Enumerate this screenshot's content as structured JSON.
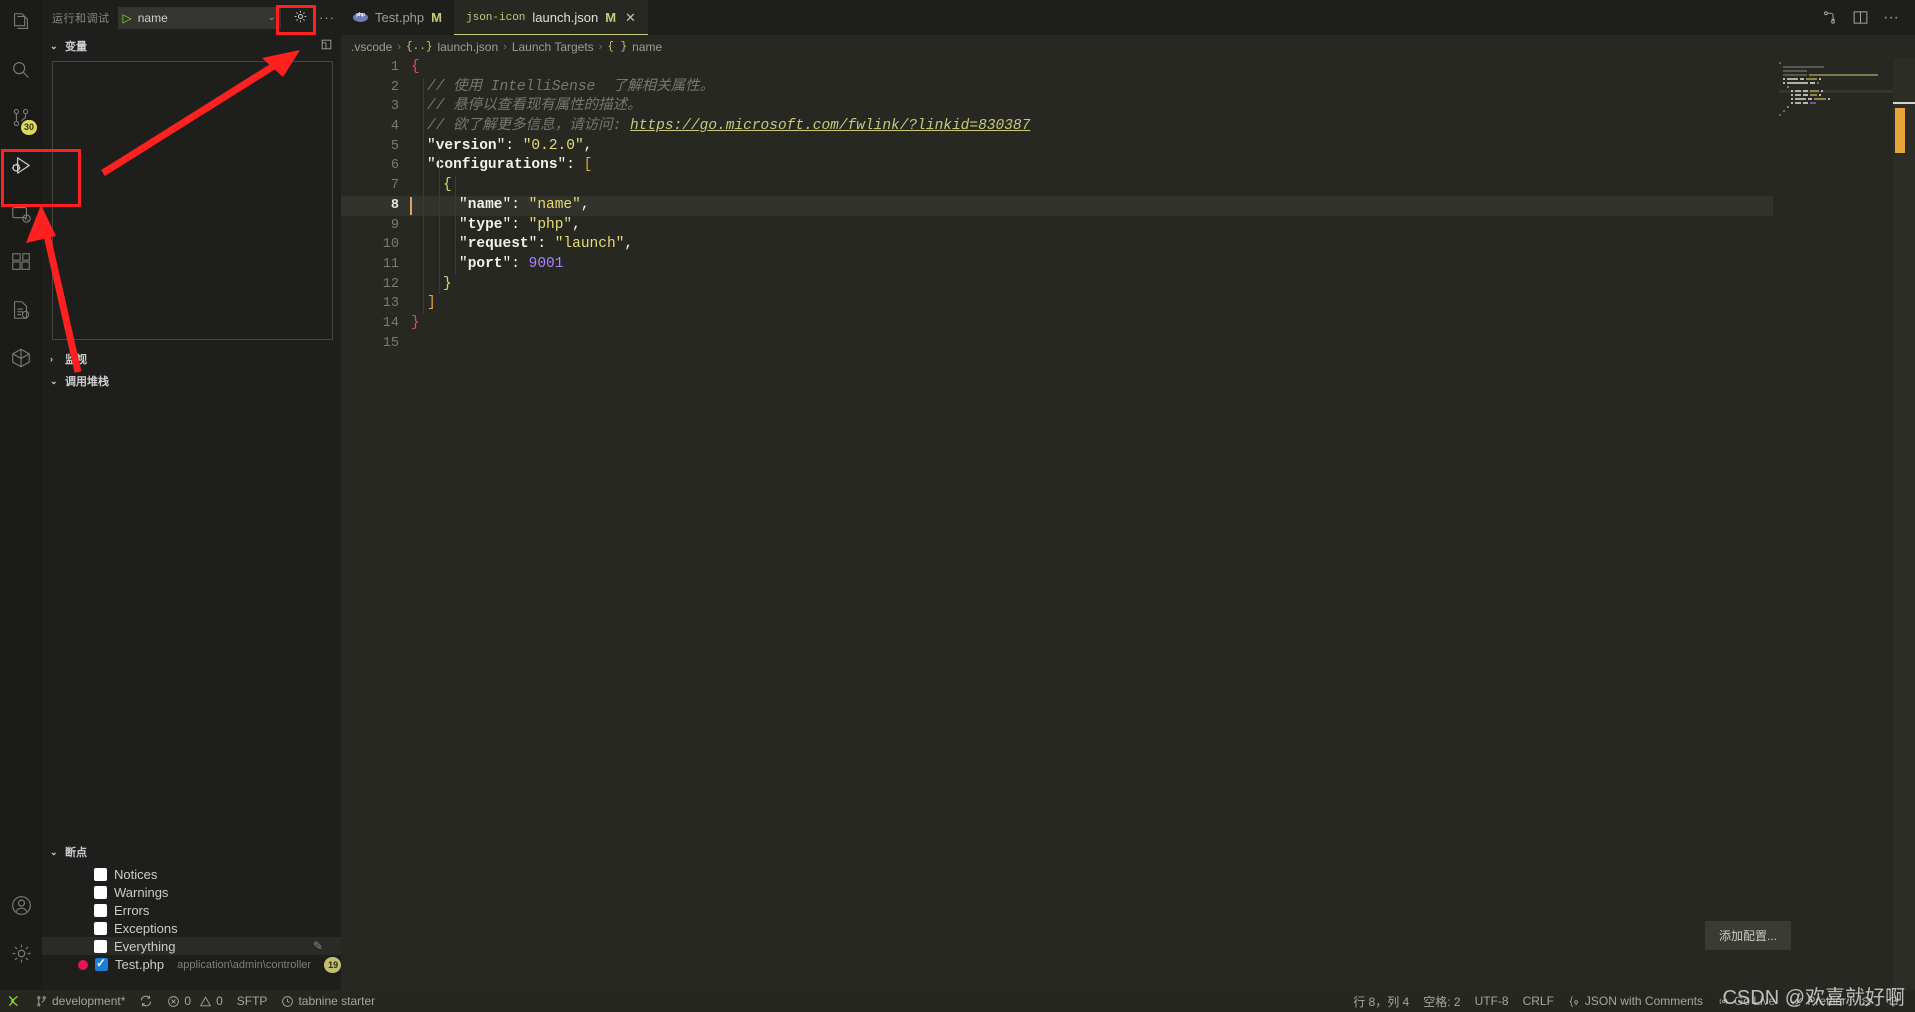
{
  "activity_bar": {
    "items": [
      {
        "name": "explorer",
        "icon": "files-icon",
        "badge": ""
      },
      {
        "name": "search",
        "icon": "search-icon",
        "badge": ""
      },
      {
        "name": "source-control",
        "icon": "source-control-icon",
        "badge": "30"
      },
      {
        "name": "run-and-debug",
        "icon": "run-debug-icon",
        "badge": "",
        "active": true
      },
      {
        "name": "remote-explorer",
        "icon": "remote-explorer-icon",
        "badge": ""
      },
      {
        "name": "extensions",
        "icon": "extensions-icon",
        "badge": ""
      },
      {
        "name": "test-explorer",
        "icon": "test-file-icon",
        "badge": ""
      },
      {
        "name": "docker",
        "icon": "docker-cube-icon",
        "badge": ""
      }
    ],
    "bottom_items": [
      {
        "name": "accounts",
        "icon": "account-icon"
      },
      {
        "name": "manage-settings",
        "icon": "gear-icon"
      }
    ]
  },
  "sidebar": {
    "title": "运行和调试",
    "config_name": "name",
    "play_glyph": "▷",
    "chevron_glyph": "⌄",
    "gear_icon": "gear-icon",
    "more_icon": "ellipsis-icon",
    "sections": {
      "variables": {
        "label": "变量",
        "expanded": true,
        "twist": "⌄",
        "action_icon": "open-in-editor-icon"
      },
      "watch": {
        "label": "监视",
        "expanded": false,
        "twist": "›"
      },
      "callstack": {
        "label": "调用堆栈",
        "expanded": true,
        "twist": "⌄"
      },
      "breakpoints": {
        "label": "断点",
        "expanded": true,
        "twist": "⌄"
      }
    },
    "breakpoints": [
      {
        "label": "Notices",
        "checked": false,
        "highlight": false
      },
      {
        "label": "Warnings",
        "checked": false,
        "highlight": false
      },
      {
        "label": "Errors",
        "checked": false,
        "highlight": false
      },
      {
        "label": "Exceptions",
        "checked": false,
        "highlight": false
      },
      {
        "label": "Everything",
        "checked": false,
        "highlight": true,
        "edit_icon": "pencil-icon"
      }
    ],
    "breakpoint_file": {
      "name": "Test.php",
      "path": "application\\admin\\controller",
      "line": "19",
      "checked": true
    }
  },
  "editor": {
    "tabs": [
      {
        "label": "Test.php",
        "dirty": "M",
        "icon": "php-icon",
        "active": false,
        "closable": false
      },
      {
        "label": "launch.json",
        "dirty": "M",
        "icon": "json-icon",
        "active": true,
        "closable": true,
        "close_glyph": "✕"
      }
    ],
    "tab_actions": [
      {
        "name": "split-editor-right-icon",
        "glyph": ""
      },
      {
        "name": "more-actions-icon",
        "glyph": "···"
      },
      {
        "name": "run-file-icon",
        "glyph": ""
      }
    ],
    "breadcrumb": [
      {
        "text": ".vscode",
        "icon": ""
      },
      {
        "text": "launch.json",
        "icon": "{..}"
      },
      {
        "text": "Launch Targets",
        "icon": ""
      },
      {
        "text": "name",
        "icon": "{ }"
      }
    ],
    "breadcrumb_sep": "›",
    "add_config_button": "添加配置...",
    "cursor_line": 8,
    "code": [
      {
        "n": 1,
        "indent": 0,
        "tokens": [
          {
            "t": "{",
            "c": "t-brace1"
          }
        ]
      },
      {
        "n": 2,
        "indent": 1,
        "tokens": [
          {
            "t": "// 使用 IntelliSense  了解相关属性。",
            "c": "t-com"
          }
        ]
      },
      {
        "n": 3,
        "indent": 1,
        "tokens": [
          {
            "t": "// 悬停以查看现有属性的描述。",
            "c": "t-com"
          }
        ]
      },
      {
        "n": 4,
        "indent": 1,
        "tokens": [
          {
            "t": "// 欲了解更多信息，请访问: ",
            "c": "t-com"
          },
          {
            "t": "https://go.microsoft.com/fwlink/?linkid=830387",
            "c": "t-link"
          }
        ]
      },
      {
        "n": 5,
        "indent": 1,
        "tokens": [
          {
            "t": "\"",
            "c": "t-punc"
          },
          {
            "t": "version",
            "c": "t-key"
          },
          {
            "t": "\": ",
            "c": "t-punc"
          },
          {
            "t": "\"0.2.0\"",
            "c": "t-str"
          },
          {
            "t": ",",
            "c": "t-punc"
          }
        ]
      },
      {
        "n": 6,
        "indent": 1,
        "tokens": [
          {
            "t": "\"",
            "c": "t-punc"
          },
          {
            "t": "configurations",
            "c": "t-key"
          },
          {
            "t": "\": ",
            "c": "t-punc"
          },
          {
            "t": "[",
            "c": "t-brace2"
          }
        ]
      },
      {
        "n": 7,
        "indent": 2,
        "tokens": [
          {
            "t": "{",
            "c": "t-brace3"
          }
        ]
      },
      {
        "n": 8,
        "indent": 3,
        "tokens": [
          {
            "t": "\"",
            "c": "t-punc"
          },
          {
            "t": "name",
            "c": "t-key"
          },
          {
            "t": "\": ",
            "c": "t-punc"
          },
          {
            "t": "\"name\"",
            "c": "t-str"
          },
          {
            "t": ",",
            "c": "t-punc"
          }
        ]
      },
      {
        "n": 9,
        "indent": 3,
        "tokens": [
          {
            "t": "\"",
            "c": "t-punc"
          },
          {
            "t": "type",
            "c": "t-key"
          },
          {
            "t": "\": ",
            "c": "t-punc"
          },
          {
            "t": "\"php\"",
            "c": "t-str"
          },
          {
            "t": ",",
            "c": "t-punc"
          }
        ]
      },
      {
        "n": 10,
        "indent": 3,
        "tokens": [
          {
            "t": "\"",
            "c": "t-punc"
          },
          {
            "t": "request",
            "c": "t-key"
          },
          {
            "t": "\": ",
            "c": "t-punc"
          },
          {
            "t": "\"launch\"",
            "c": "t-str"
          },
          {
            "t": ",",
            "c": "t-punc"
          }
        ]
      },
      {
        "n": 11,
        "indent": 3,
        "tokens": [
          {
            "t": "\"",
            "c": "t-punc"
          },
          {
            "t": "port",
            "c": "t-key"
          },
          {
            "t": "\": ",
            "c": "t-punc"
          },
          {
            "t": "9001",
            "c": "t-num"
          }
        ]
      },
      {
        "n": 12,
        "indent": 2,
        "tokens": [
          {
            "t": "}",
            "c": "t-brace3"
          }
        ]
      },
      {
        "n": 13,
        "indent": 1,
        "tokens": [
          {
            "t": "]",
            "c": "t-brace2"
          }
        ]
      },
      {
        "n": 14,
        "indent": 0,
        "tokens": [
          {
            "t": "}",
            "c": "t-brace1"
          }
        ]
      },
      {
        "n": 15,
        "indent": 0,
        "tokens": []
      }
    ]
  },
  "statusbar": {
    "left": [
      {
        "name": "remote-indicator",
        "icon": "remote-icon",
        "label": ""
      },
      {
        "name": "branch",
        "icon": "git-branch-icon",
        "label": "development*"
      },
      {
        "name": "sync",
        "icon": "sync-icon",
        "label": ""
      },
      {
        "name": "problems",
        "icon": "error-warning-icon",
        "label": "0  0",
        "errors": "0",
        "warnings": "0"
      },
      {
        "name": "sftp",
        "icon": "",
        "label": "SFTP"
      },
      {
        "name": "tabnine",
        "icon": "clock-icon",
        "label": "tabnine starter"
      }
    ],
    "right": [
      {
        "name": "cursor-position",
        "label": "行 8，列 4"
      },
      {
        "name": "indentation",
        "label": "空格: 2"
      },
      {
        "name": "encoding",
        "label": "UTF-8"
      },
      {
        "name": "eol",
        "label": "CRLF"
      },
      {
        "name": "language-mode",
        "label": "JSON with Comments",
        "icon": "json-braces-icon"
      },
      {
        "name": "go-live",
        "label": "Go Live",
        "icon": "broadcast-icon"
      },
      {
        "name": "prettier",
        "label": "Prettier",
        "icon": "check-icon"
      },
      {
        "name": "tabnine-status",
        "label": "",
        "icon": "tabnine-icon"
      },
      {
        "name": "notifications",
        "label": "",
        "icon": "bell-icon"
      }
    ]
  },
  "watermark": "CSDN @欢喜就好啊",
  "colors": {
    "editor_bg": "#272822",
    "sidebar_bg": "#1e1f1c",
    "activity_bg": "#1b1c18",
    "accent_green": "#8ddb2a",
    "accent_yellow": "#c9c97a",
    "annotation_red": "#ff2020",
    "breakpoint_red": "#e51456",
    "string_yellow": "#e6db74",
    "number_purple": "#ae81ff"
  }
}
